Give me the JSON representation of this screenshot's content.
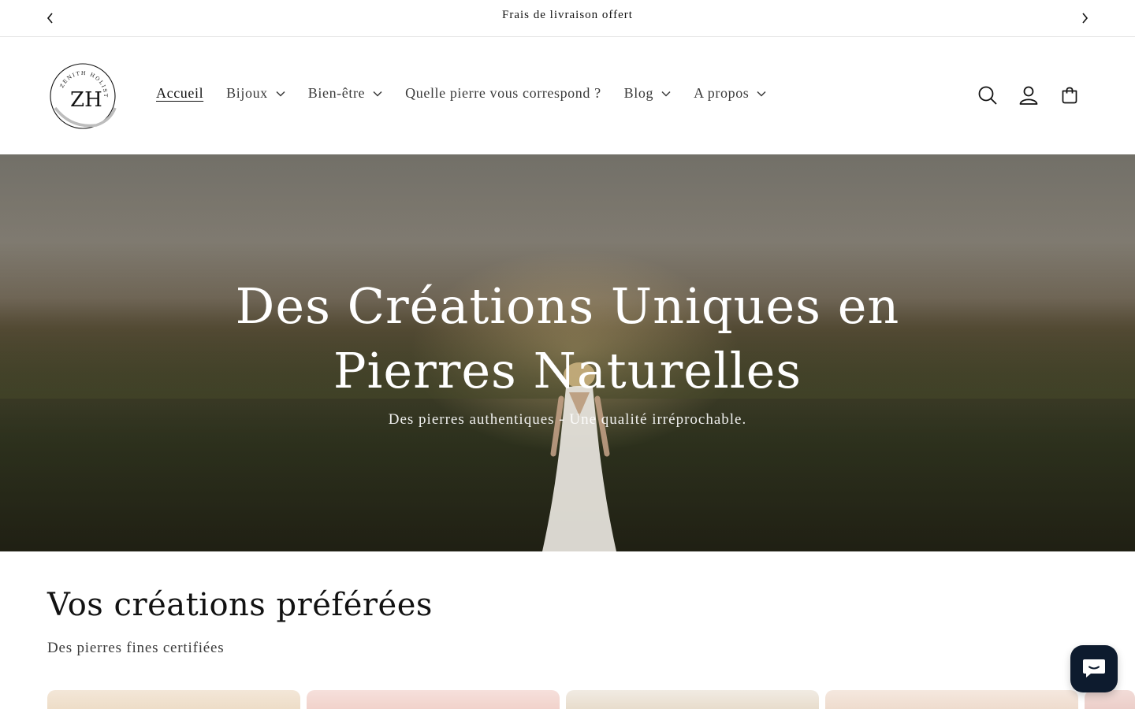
{
  "announcement": {
    "text": "Frais de livraison offert",
    "prev_icon": "chevron-left-icon",
    "next_icon": "chevron-right-icon"
  },
  "header": {
    "logo": {
      "initials": "ZH",
      "ring_text": "ZENITH HOLISTIC"
    },
    "nav": [
      {
        "label": "Accueil",
        "active": true,
        "has_dropdown": false
      },
      {
        "label": "Bijoux",
        "active": false,
        "has_dropdown": true
      },
      {
        "label": "Bien-être",
        "active": false,
        "has_dropdown": true
      },
      {
        "label": "Quelle pierre vous correspond ?",
        "active": false,
        "has_dropdown": false
      },
      {
        "label": "Blog",
        "active": false,
        "has_dropdown": true
      },
      {
        "label": "A propos",
        "active": false,
        "has_dropdown": true
      }
    ],
    "icons": [
      "search-icon",
      "account-icon",
      "cart-icon"
    ]
  },
  "hero": {
    "title": "Des Créations Uniques en Pierres Naturelles",
    "subtitle": "Des pierres authentiques - Une qualité irréprochable."
  },
  "collection": {
    "title": "Vos créations préférées",
    "subtitle": "Des pierres fines certifiées",
    "card_count": 5
  },
  "chat": {
    "icon": "chat-bubble-icon"
  },
  "colors": {
    "text": "#121212",
    "nav_text": "#3a3a3a",
    "chat_bg": "#0d1b2e",
    "hero_text": "#ffffff"
  }
}
